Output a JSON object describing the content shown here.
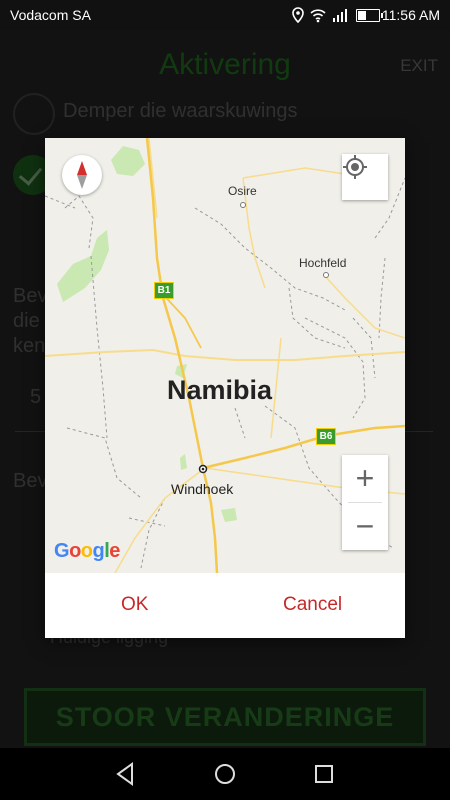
{
  "status_bar": {
    "carrier": "Vodacom SA",
    "time": "11:56 AM",
    "battery_level": 0.35
  },
  "app_bar": {
    "title": "Aktivering",
    "exit_label": "EXIT"
  },
  "background": {
    "mute_label": "Demper die waarskuwings",
    "text_fragments": [
      "Bev",
      "die",
      "ken",
      "5",
      "Bev"
    ],
    "location_label": "Huidige ligging",
    "save_button": "STOOR VERANDERINGE"
  },
  "map": {
    "country": "Namibia",
    "cities": [
      "Osire",
      "Hochfeld",
      "Windhoek"
    ],
    "routes": [
      "B1",
      "B6"
    ],
    "attribution": "Google",
    "zoom_in": "+",
    "zoom_out": "−"
  },
  "dialog": {
    "ok_label": "OK",
    "cancel_label": "Cancel"
  },
  "colors": {
    "accent_red": "#c62828",
    "app_green": "#1b5a1b",
    "route_green": "#3a9c2c"
  }
}
